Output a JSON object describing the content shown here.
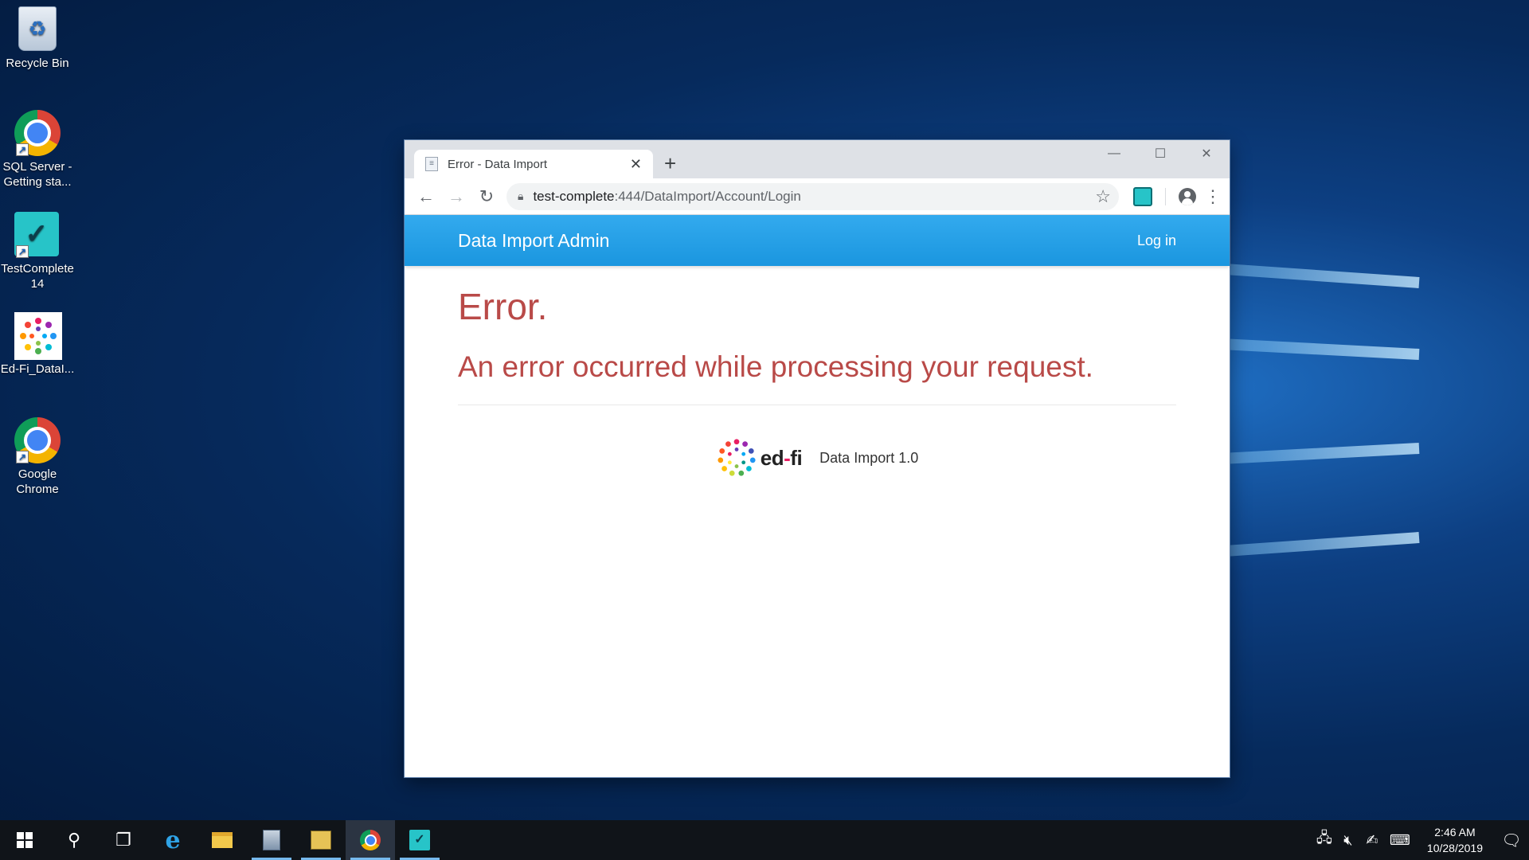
{
  "desktop": {
    "icons": [
      {
        "label": "Recycle Bin"
      },
      {
        "label": "SQL Server - Getting sta..."
      },
      {
        "label": "TestComplete 14"
      },
      {
        "label": "Ed-Fi_DataI..."
      },
      {
        "label": "Google Chrome"
      }
    ]
  },
  "browser": {
    "tab_title": "Error - Data Import",
    "url_host": "test-complete",
    "url_path": ":444/DataImport/Account/Login"
  },
  "app": {
    "brand": "Data Import Admin",
    "login": "Log in",
    "error_title": "Error.",
    "error_message": "An error occurred while processing your request.",
    "footer_logo_text_a": "ed",
    "footer_logo_text_b": "-",
    "footer_logo_text_c": "fi",
    "footer_version": "Data Import 1.0"
  },
  "taskbar": {
    "time": "2:46 AM",
    "date": "10/28/2019"
  }
}
